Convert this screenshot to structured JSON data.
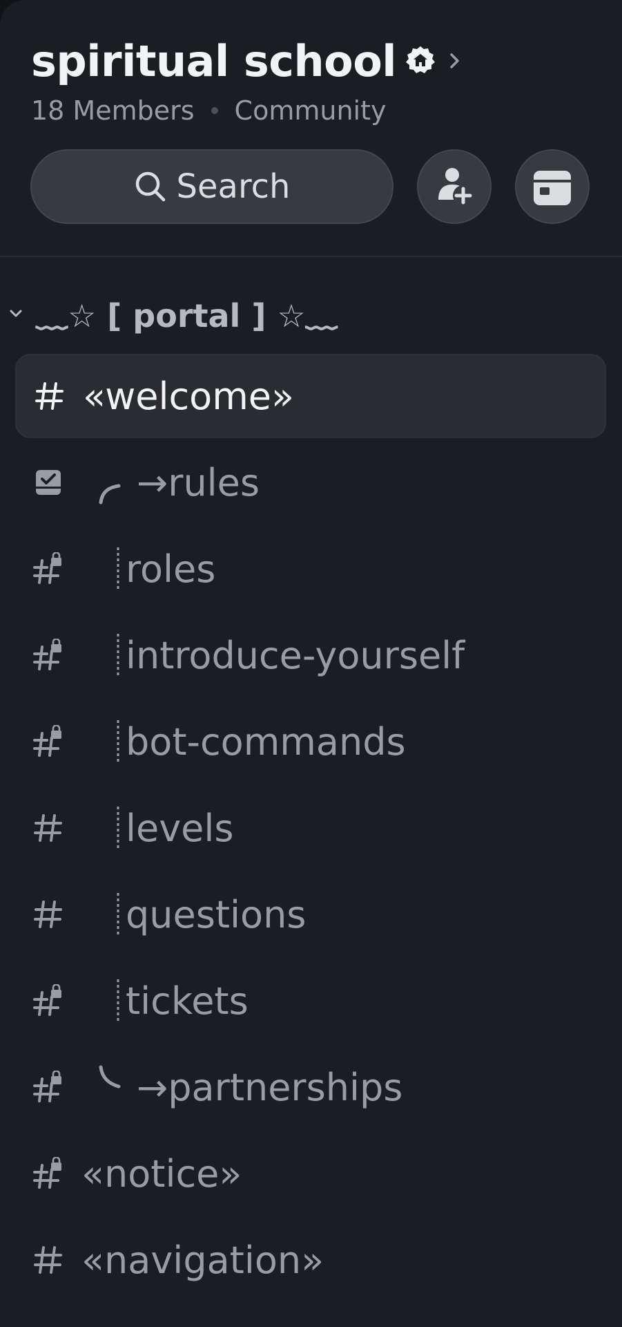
{
  "server": {
    "name": "spiritual school",
    "members": "18 Members",
    "type": "Community"
  },
  "search": {
    "label": "Search"
  },
  "category": {
    "label": "﹏☆ [ portal ] ☆﹏"
  },
  "channels": [
    {
      "name": "«welcome»",
      "icon": "hash-icon",
      "prefix": "none",
      "selected": true
    },
    {
      "name": "↗→rules",
      "icon": "rules-icon",
      "prefix": "curve-up"
    },
    {
      "name": "roles",
      "icon": "locked-hash-icon",
      "prefix": "dotted-line"
    },
    {
      "name": "introduce-yourself",
      "icon": "locked-hash-icon",
      "prefix": "dotted-line"
    },
    {
      "name": "bot-commands",
      "icon": "locked-hash-icon",
      "prefix": "dotted-line"
    },
    {
      "name": "levels",
      "icon": "hash-icon",
      "prefix": "dotted-line"
    },
    {
      "name": "questions",
      "icon": "hash-icon",
      "prefix": "dotted-line"
    },
    {
      "name": "tickets",
      "icon": "locked-hash-icon",
      "prefix": "dotted-line"
    },
    {
      "name": "→partnerships",
      "icon": "locked-hash-icon",
      "prefix": "curve-down"
    },
    {
      "name": "«notice»",
      "icon": "locked-hash-icon",
      "prefix": "none"
    },
    {
      "name": "«navigation»",
      "icon": "hash-icon",
      "prefix": "none"
    }
  ],
  "colors": {
    "background": "#1c1d22",
    "selected_row": "#2b2c31",
    "button_bg": "#383a40",
    "text_primary": "#f2f3f5",
    "text_muted": "#9a9ca5"
  }
}
